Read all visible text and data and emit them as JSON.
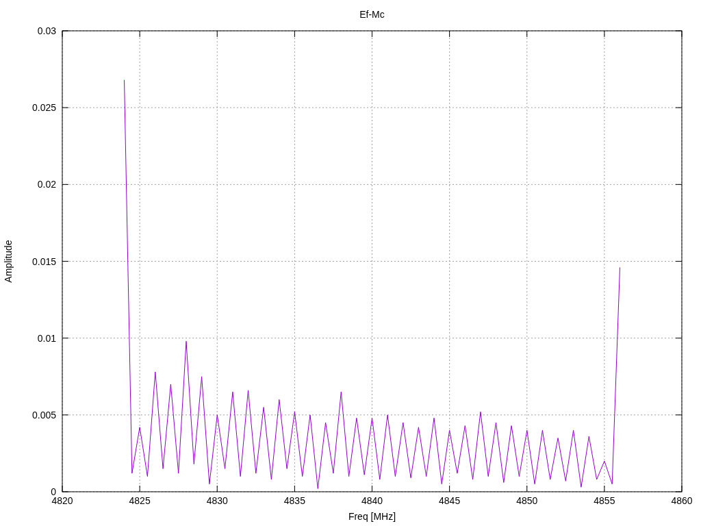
{
  "chart_data": {
    "type": "line",
    "title": "Ef-Mc",
    "xlabel": "Freq [MHz]",
    "ylabel": "Amplitude",
    "xlim": [
      4820,
      4860
    ],
    "ylim": [
      0,
      0.03
    ],
    "grid": true,
    "xticks": [
      4820,
      4825,
      4830,
      4835,
      4840,
      4845,
      4850,
      4855,
      4860
    ],
    "yticks": [
      0,
      0.005,
      0.01,
      0.015,
      0.02,
      0.025,
      0.03
    ],
    "x": [
      4824,
      4824.5,
      4825,
      4825.5,
      4826,
      4826.5,
      4827,
      4827.5,
      4828,
      4828.5,
      4829,
      4829.5,
      4830,
      4830.5,
      4831,
      4831.5,
      4832,
      4832.5,
      4833,
      4833.5,
      4834,
      4834.5,
      4835,
      4835.5,
      4836,
      4836.5,
      4837,
      4837.5,
      4838,
      4838.5,
      4839,
      4839.5,
      4840,
      4840.5,
      4841,
      4841.5,
      4842,
      4842.5,
      4843,
      4843.5,
      4844,
      4844.5,
      4845,
      4845.5,
      4846,
      4846.5,
      4847,
      4847.5,
      4848,
      4848.5,
      4849,
      4849.5,
      4850,
      4850.5,
      4851,
      4851.5,
      4852,
      4852.5,
      4853,
      4853.5,
      4854,
      4854.5,
      4855,
      4855.5,
      4856
    ],
    "series": [
      {
        "color": "#9400d3",
        "values": [
          0.0268,
          0.0012,
          0.0042,
          0.001,
          0.0078,
          0.0015,
          0.007,
          0.0012,
          0.0098,
          0.0018,
          0.0075,
          0.0005,
          0.005,
          0.0015,
          0.0065,
          0.001,
          0.0066,
          0.0012,
          0.0055,
          0.0008,
          0.006,
          0.0015,
          0.0052,
          0.001,
          0.005,
          0.0002,
          0.0045,
          0.0012,
          0.0065,
          0.001,
          0.0048,
          0.0011,
          0.0048,
          0.0008,
          0.005,
          0.001,
          0.0045,
          0.0009,
          0.0042,
          0.001,
          0.0048,
          0.0005,
          0.004,
          0.0012,
          0.0043,
          0.0008,
          0.0052,
          0.001,
          0.0045,
          0.0006,
          0.0043,
          0.001,
          0.004,
          0.0005,
          0.004,
          0.0008,
          0.0035,
          0.0007,
          0.004,
          0.0003,
          0.0036,
          0.0008,
          0.002,
          0.0005,
          0.0146
        ]
      }
    ]
  }
}
